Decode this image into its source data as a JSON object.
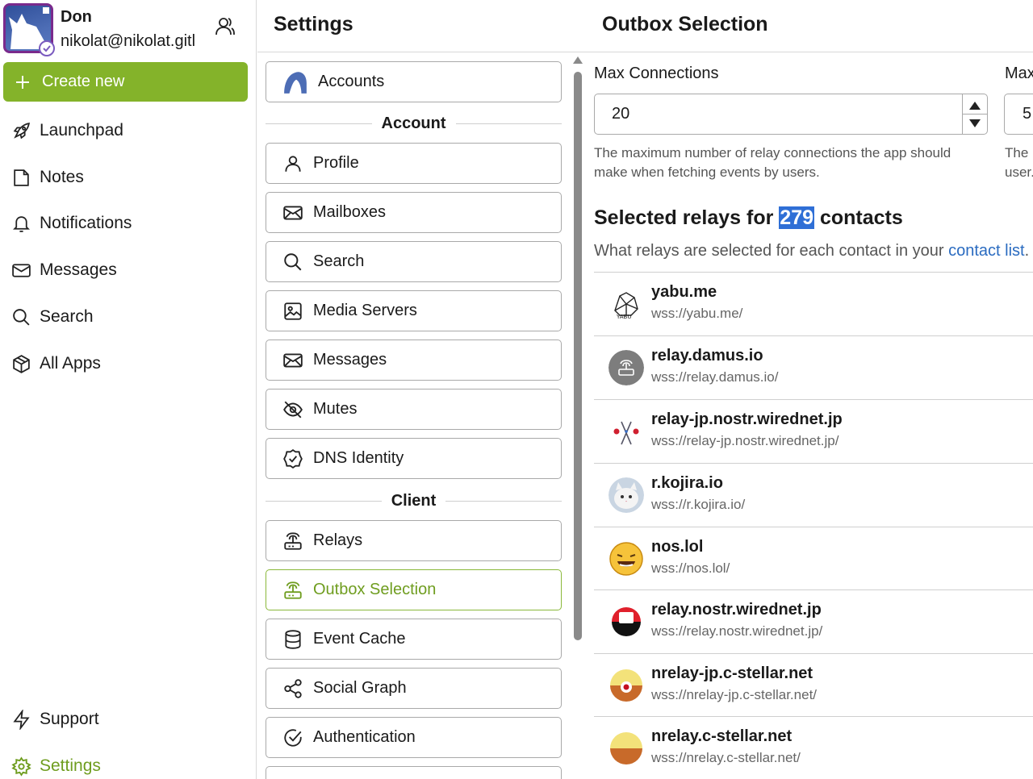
{
  "user": {
    "name": "Don",
    "email": "nikolat@nikolat.gitl"
  },
  "sidebar": {
    "create_label": "Create new",
    "items": [
      {
        "label": "Launchpad",
        "icon": "rocket-icon"
      },
      {
        "label": "Notes",
        "icon": "note-icon"
      },
      {
        "label": "Notifications",
        "icon": "bell-icon"
      },
      {
        "label": "Messages",
        "icon": "mail-icon"
      },
      {
        "label": "Search",
        "icon": "search-icon"
      },
      {
        "label": "All Apps",
        "icon": "package-icon"
      }
    ],
    "bottom": [
      {
        "label": "Support",
        "icon": "bolt-icon"
      },
      {
        "label": "Settings",
        "icon": "gear-icon"
      }
    ]
  },
  "header": {
    "settings_title": "Settings",
    "page_title": "Outbox Selection"
  },
  "menu": {
    "accounts": "Accounts",
    "section_account": "Account",
    "account_items": [
      "Profile",
      "Mailboxes",
      "Search",
      "Media Servers",
      "Messages",
      "Mutes",
      "DNS Identity"
    ],
    "section_client": "Client",
    "client_items": [
      "Relays",
      "Outbox Selection",
      "Event Cache",
      "Social Graph",
      "Authentication"
    ]
  },
  "outbox": {
    "max_connections_label": "Max Connections",
    "max_connections_value": "20",
    "second_label": "Max",
    "second_value": "5",
    "help": "The maximum number of relay connections the app should make when fetching events by users.",
    "help2_line1": "The r",
    "help2_line2": "user.",
    "selected_prefix": "Selected relays for",
    "selected_count": "279",
    "selected_suffix": "contacts",
    "subtitle_prefix": "What relays are selected for each contact in your",
    "subtitle_link": "contact list",
    "subtitle_end": "."
  },
  "relays": [
    {
      "name": "yabu.me",
      "url": "wss://yabu.me/"
    },
    {
      "name": "relay.damus.io",
      "url": "wss://relay.damus.io/"
    },
    {
      "name": "relay-jp.nostr.wirednet.jp",
      "url": "wss://relay-jp.nostr.wirednet.jp/"
    },
    {
      "name": "r.kojira.io",
      "url": "wss://r.kojira.io/"
    },
    {
      "name": "nos.lol",
      "url": "wss://nos.lol/"
    },
    {
      "name": "relay.nostr.wirednet.jp",
      "url": "wss://relay.nostr.wirednet.jp/"
    },
    {
      "name": "nrelay-jp.c-stellar.net",
      "url": "wss://nrelay-jp.c-stellar.net/"
    },
    {
      "name": "nrelay.c-stellar.net",
      "url": "wss://nrelay.c-stellar.net/"
    }
  ],
  "colors": {
    "accent": "#84b32a",
    "accent_text": "#6f9d1f",
    "link": "#2a6bc0",
    "highlight": "#2f6fd6"
  }
}
